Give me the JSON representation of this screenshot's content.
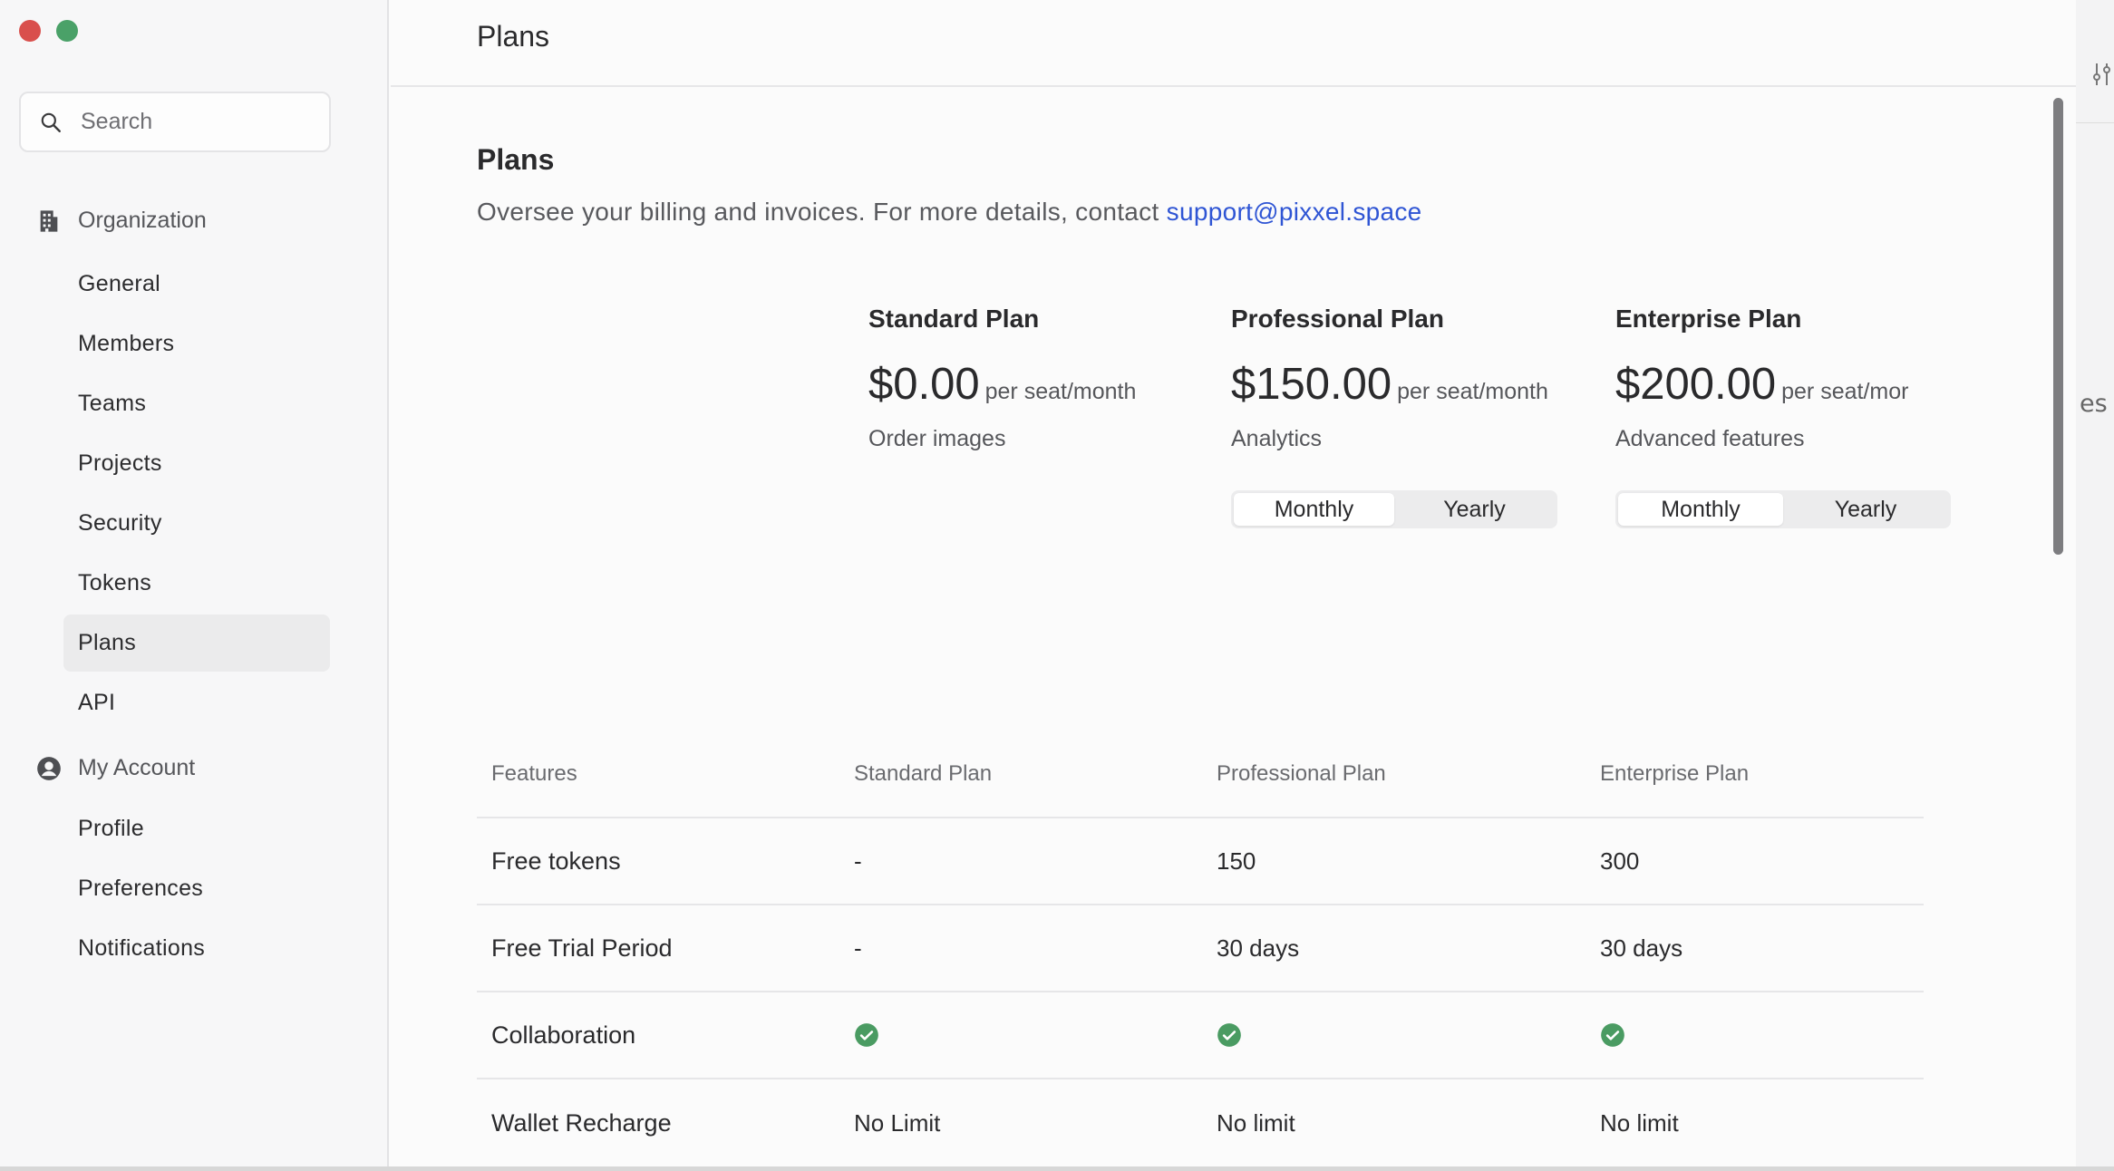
{
  "window": {
    "title": "Plans"
  },
  "sidebar": {
    "search": {
      "placeholder": "Search"
    },
    "organization": {
      "label": "Organization",
      "items": [
        {
          "label": "General"
        },
        {
          "label": "Members"
        },
        {
          "label": "Teams"
        },
        {
          "label": "Projects"
        },
        {
          "label": "Security"
        },
        {
          "label": "Tokens"
        },
        {
          "label": "Plans",
          "active": true
        },
        {
          "label": "API"
        }
      ]
    },
    "account": {
      "label": "My Account",
      "items": [
        {
          "label": "Profile"
        },
        {
          "label": "Preferences"
        },
        {
          "label": "Notifications"
        }
      ]
    }
  },
  "main": {
    "header_title": "Plans",
    "title": "Plans",
    "subtitle": "Oversee your billing and invoices. For more details, contact ",
    "support_email": "support@pixxel.space",
    "plans": [
      {
        "name": "Standard Plan",
        "price": "$0.00",
        "per": "per seat/month",
        "desc": "Order images"
      },
      {
        "name": "Professional Plan",
        "price": "$150.00",
        "per": "per seat/month",
        "desc": "Analytics",
        "toggle": {
          "monthly": "Monthly",
          "yearly": "Yearly",
          "selected": "Monthly"
        }
      },
      {
        "name": "Enterprise Plan",
        "price": "$200.00",
        "per": "per seat/mor",
        "desc": "Advanced features",
        "toggle": {
          "monthly": "Monthly",
          "yearly": "Yearly",
          "selected": "Monthly"
        }
      }
    ],
    "table": {
      "headers": [
        "Features",
        "Standard Plan",
        "Professional Plan",
        "Enterprise Plan"
      ],
      "rows": [
        [
          "Free tokens",
          "-",
          "150",
          "300"
        ],
        [
          "Free Trial Period",
          "-",
          "30 days",
          "30 days"
        ],
        [
          "Collaboration",
          "check",
          "check",
          "check"
        ],
        [
          "Wallet Recharge",
          "No Limit",
          "No limit",
          "No limit"
        ]
      ]
    }
  },
  "background": {
    "partial_text": "es"
  },
  "colors": {
    "accent": "#2f55d4",
    "check": "#4a9b62",
    "close": "#d94f4c",
    "zoom": "#4aa168"
  },
  "icons": [
    "search-icon",
    "building-icon",
    "user-circle-icon",
    "check-circle-icon",
    "sliders-icon"
  ]
}
